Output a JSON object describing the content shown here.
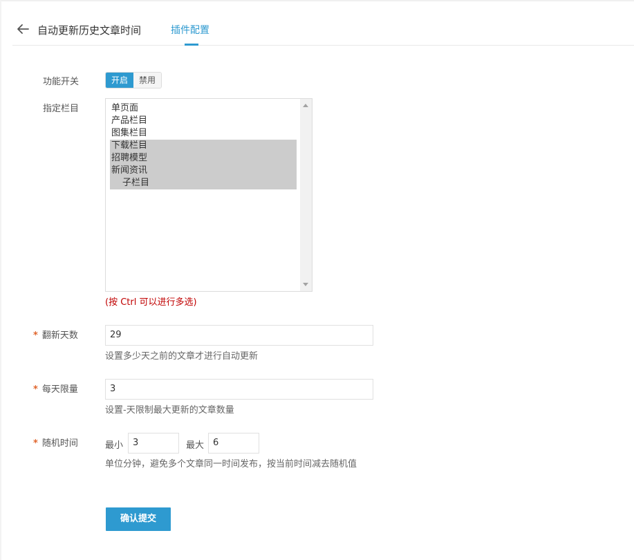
{
  "header": {
    "title": "自动更新历史文章时间",
    "tab": "插件配置"
  },
  "form": {
    "switch": {
      "label": "功能开关",
      "on": "开启",
      "off": "禁用",
      "selected": "开启"
    },
    "columns": {
      "label": "指定栏目",
      "options": [
        {
          "text": "单页面",
          "selected": false,
          "indent": false
        },
        {
          "text": "产品栏目",
          "selected": false,
          "indent": false
        },
        {
          "text": "图集栏目",
          "selected": false,
          "indent": false
        },
        {
          "text": "下载栏目",
          "selected": true,
          "indent": false
        },
        {
          "text": "招聘模型",
          "selected": true,
          "indent": false
        },
        {
          "text": "新闻资讯",
          "selected": true,
          "indent": false
        },
        {
          "text": "子栏目",
          "selected": true,
          "indent": true
        }
      ],
      "hint": "(按 Ctrl 可以进行多选)"
    },
    "days": {
      "label": "翻新天数",
      "value": "29",
      "help": "设置多少天之前的文章才进行自动更新"
    },
    "limit": {
      "label": "每天限量",
      "value": "3",
      "help": "设置-天限制最大更新的文章数量"
    },
    "random": {
      "label": "随机时间",
      "min_label": "最小",
      "min_value": "3",
      "max_label": "最大",
      "max_value": "6",
      "help": "单位分钟，避免多个文章同一时间发布，按当前时间减去随机值"
    },
    "required_mark": "*",
    "submit": "确认提交"
  }
}
